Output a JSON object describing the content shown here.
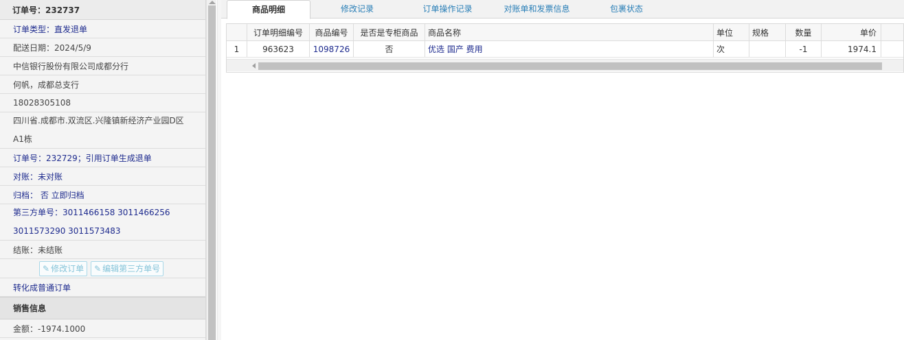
{
  "order": {
    "header_label": "订单号：232737",
    "rows": [
      {
        "text": "订单类型：直发退单",
        "style": "blue"
      },
      {
        "text": "配送日期：2024/5/9",
        "style": "dark"
      },
      {
        "text": "中信银行股份有限公司成都分行",
        "style": "dark"
      },
      {
        "text": "何帆，成都总支行",
        "style": "dark"
      },
      {
        "text": "18028305108",
        "style": "dark"
      }
    ],
    "address_line1": "四川省.成都市.双流区.兴隆镇新经济产业园D区",
    "address_line2": "A1栋",
    "ref_order": "订单号：232729；引用订单生成退单",
    "reconcile": "对账：未对账",
    "archive": "归档： 否 立即归档",
    "third_party_line1": "第三方单号：3011466158 3011466256",
    "third_party_line2": "3011573290 3011573483",
    "settlement": "结账：未结账",
    "buttons": {
      "edit_order": "修改订单",
      "edit_third_party": "编辑第三方单号"
    },
    "convert_link": "转化成普通订单",
    "sales_section": "销售信息",
    "amount": "金额：-1974.1000"
  },
  "tabs": [
    {
      "label": "商品明细",
      "active": true
    },
    {
      "label": "修改记录",
      "active": false
    },
    {
      "label": "订单操作记录",
      "active": false
    },
    {
      "label": "对账单和发票信息",
      "active": false
    },
    {
      "label": "包裹状态",
      "active": false
    }
  ],
  "grid": {
    "columns": {
      "line_no": "订单明细编号",
      "product_code": "商品编号",
      "dedicated": "是否是专柜商品",
      "product_name": "商品名称",
      "unit": "单位",
      "spec": "规格",
      "qty": "数量",
      "price": "单价"
    },
    "rows": [
      {
        "idx": "1",
        "line_no": "963623",
        "product_code": "1098726",
        "dedicated": "否",
        "product_name": "优选 国产 费用",
        "unit": "次",
        "spec": "",
        "qty": "-1",
        "price": "1974.1"
      }
    ]
  }
}
